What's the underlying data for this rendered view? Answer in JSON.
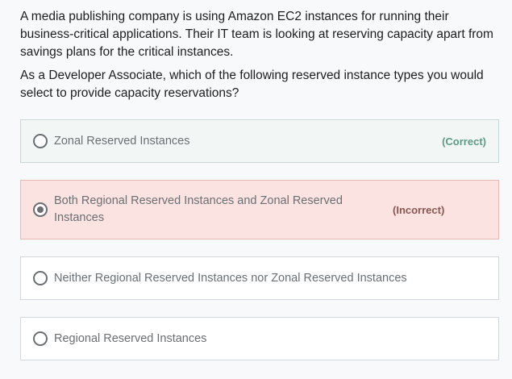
{
  "question": {
    "paragraph_1": "A media publishing company is using Amazon EC2 instances for running their business-critical applications. Their IT team is looking at reserving capacity apart from savings plans for the critical instances.",
    "paragraph_2": "As a Developer Associate, which of the following reserved instance types you would select to provide capacity reservations?"
  },
  "options": [
    {
      "label": "Zonal Reserved Instances",
      "status": "(Correct)",
      "selected": false,
      "state": "correct"
    },
    {
      "label": "Both Regional Reserved Instances and Zonal Reserved Instances",
      "status": "(Incorrect)",
      "selected": true,
      "state": "incorrect"
    },
    {
      "label": "Neither Regional Reserved Instances nor Zonal Reserved Instances",
      "status": "",
      "selected": false,
      "state": "neutral"
    },
    {
      "label": "Regional Reserved Instances",
      "status": "",
      "selected": false,
      "state": "neutral"
    }
  ],
  "colors": {
    "correct_background": "#f2f7f6",
    "correct_text": "#5d9a86",
    "incorrect_background": "#fbe3e1",
    "incorrect_text": "#8a5752"
  }
}
